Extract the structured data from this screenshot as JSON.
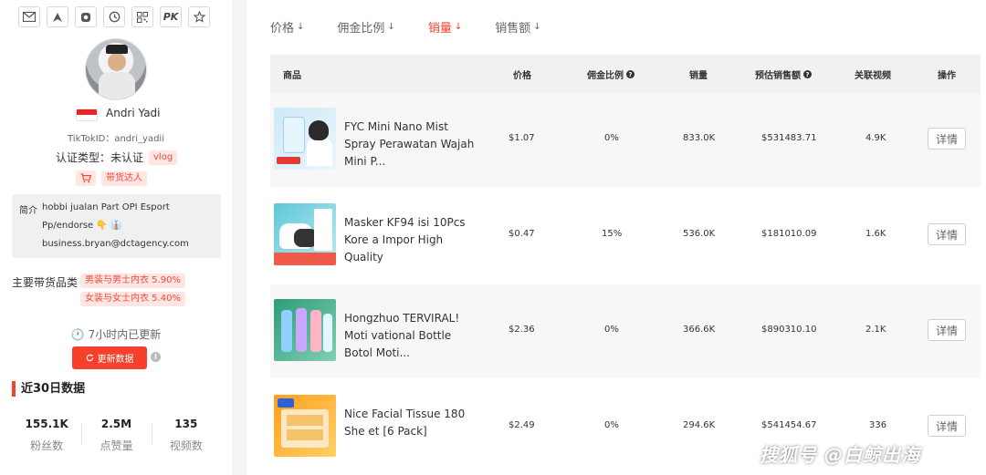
{
  "profile": {
    "toolbar_icons": [
      "mail-icon",
      "send-icon",
      "instagram-icon",
      "history-icon",
      "qrcode-icon",
      "pk-icon",
      "star-icon"
    ],
    "pk_label": "PK",
    "name": "Andri Yadi",
    "tiktok_id": "TikTokID：andri_yadii",
    "auth_label": "认证类型：未认证",
    "auth_tag": "vlog",
    "seller_tag": "带货达人",
    "bio_label": "简介",
    "bio_lines": [
      "hobbi jualan Part OPI Esport",
      "Pp/endorse 👇 👔",
      "business.bryan@dctagency.com"
    ],
    "categories_label": "主要带货品类",
    "categories": [
      "男装与男士内衣 5.90%",
      "女装与女士内衣 5.40%"
    ],
    "updated": "🕐 7小时内已更新",
    "refresh_label": "更新数据",
    "section_title": "近30日数据",
    "stats": [
      {
        "value": "155.1K",
        "label": "粉丝数"
      },
      {
        "value": "2.5M",
        "label": "点赞量"
      },
      {
        "value": "135",
        "label": "视频数"
      }
    ],
    "colors": {
      "accent": "#f5402c",
      "tag_bg": "#ffe6e3"
    }
  },
  "sort_tabs": [
    {
      "label": "价格",
      "active": false
    },
    {
      "label": "佣金比例",
      "active": false
    },
    {
      "label": "销量",
      "active": true
    },
    {
      "label": "销售额",
      "active": false
    }
  ],
  "table": {
    "headers": [
      "商品",
      "价格",
      "佣金比例",
      "销量",
      "预估销售额",
      "关联视频",
      "操作"
    ],
    "rows": [
      {
        "name": "FYC Mini Nano Mist Spray Perawatan Wajah Mini P...",
        "price": "$1.07",
        "commission": "0%",
        "sales": "833.0K",
        "revenue": "$531483.71",
        "videos": "4.9K",
        "action": "详情"
      },
      {
        "name": "Masker KF94 isi 10Pcs Kore a Impor High Quality",
        "price": "$0.47",
        "commission": "15%",
        "sales": "536.0K",
        "revenue": "$181010.09",
        "videos": "1.6K",
        "action": "详情"
      },
      {
        "name": "Hongzhuo TERVIRAL! Moti vational Bottle Botol Moti...",
        "price": "$2.36",
        "commission": "0%",
        "sales": "366.6K",
        "revenue": "$890310.10",
        "videos": "2.1K",
        "action": "详情"
      },
      {
        "name": "Nice Facial Tissue 180 She et [6 Pack]",
        "price": "$2.49",
        "commission": "0%",
        "sales": "294.6K",
        "revenue": "$541454.67",
        "videos": "336",
        "action": "详情"
      }
    ]
  },
  "watermark": "搜狐号 @白鲸出海"
}
